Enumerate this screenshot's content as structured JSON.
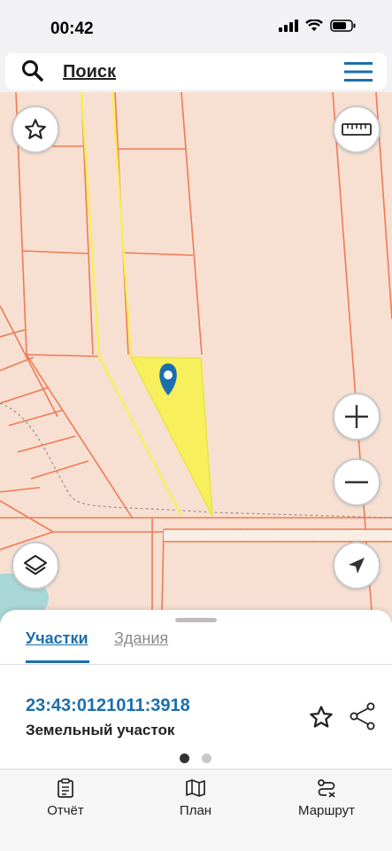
{
  "status_bar": {
    "time": "00:42"
  },
  "search": {
    "placeholder": "Поиск"
  },
  "map": {
    "parcel_highlight_color": "#f7ef5c",
    "marker_color": "#1a6fae"
  },
  "sheet": {
    "tabs": [
      {
        "label": "Участки",
        "active": true
      },
      {
        "label": "Здания",
        "active": false
      }
    ],
    "parcel": {
      "cadastral_number": "23:43:0121011:3918",
      "type": "Земельный участок"
    },
    "page_count": 2,
    "current_page": 1
  },
  "bottom_nav": [
    {
      "label": "Отчёт",
      "icon": "report-icon"
    },
    {
      "label": "План",
      "icon": "map-plan-icon"
    },
    {
      "label": "Маршрут",
      "icon": "route-icon"
    }
  ],
  "colors": {
    "accent": "#1a6fae",
    "map_background": "#f7e0d2",
    "parcel_border": "#f07a55"
  }
}
